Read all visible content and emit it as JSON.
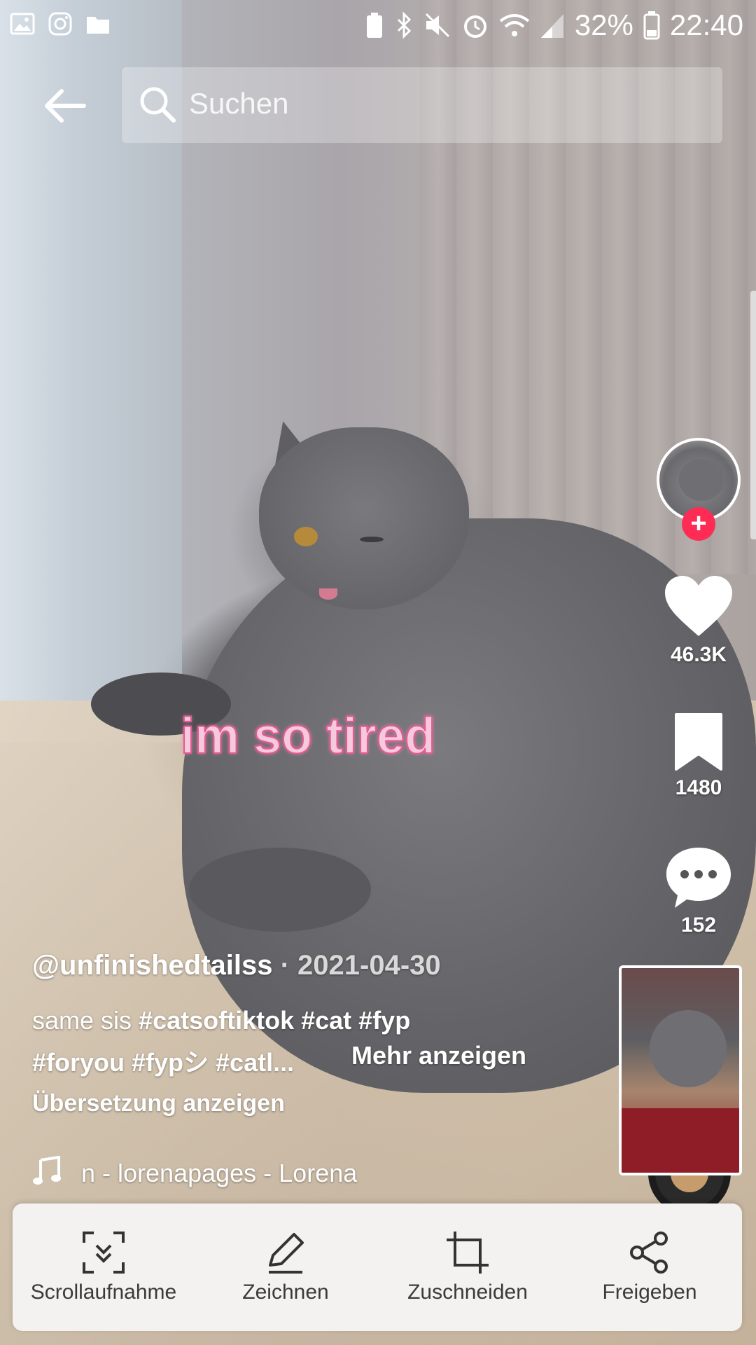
{
  "status_bar": {
    "battery_percent": "32%",
    "time": "22:40"
  },
  "search": {
    "placeholder": "Suchen"
  },
  "video": {
    "overlay_caption": "im so tired"
  },
  "side_rail": {
    "likes": "46.3K",
    "saves": "1480",
    "comments": "152"
  },
  "post": {
    "author": "@unfinishedtailss",
    "separator": " · ",
    "date": "2021-04-30",
    "desc_line1_prefix": "same sis ",
    "desc_line1_tags": "#catsoftiktok #cat #fyp",
    "desc_line2": "#foryou #fypシ #catl...",
    "more_label": "Mehr anzeigen",
    "translate_label": "Übersetzung anzeigen",
    "music_text": "n - lorenapages - Lorena"
  },
  "action_sheet": {
    "items": [
      {
        "label": "Scrollaufnahme",
        "icon": "scroll-capture-icon"
      },
      {
        "label": "Zeichnen",
        "icon": "pen-icon"
      },
      {
        "label": "Zuschneiden",
        "icon": "crop-icon"
      },
      {
        "label": "Freigeben",
        "icon": "share-icon"
      }
    ]
  },
  "colors": {
    "follow_accent": "#fe2c55",
    "caption_pink": "#f6c9dd"
  }
}
